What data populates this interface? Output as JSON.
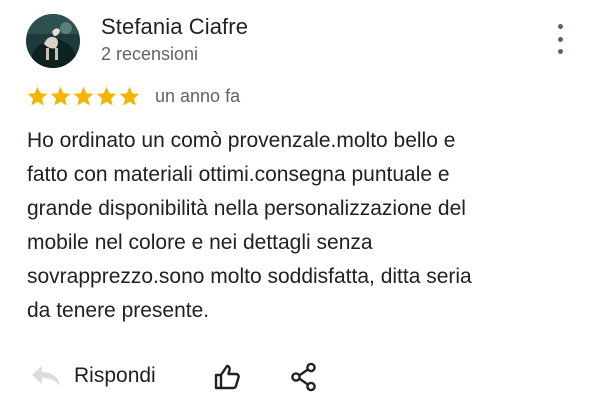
{
  "review": {
    "author": {
      "name": "Stefania Ciafre",
      "meta": "2 recensioni",
      "avatar_icon": "profile-photo-avatar"
    },
    "menu_icon": "more-vert-icon",
    "rating": {
      "stars": 5,
      "max": 5,
      "star_color": "#f4b400",
      "time": "un anno fa"
    },
    "text": "Ho ordinato un comò  provenzale.molto bello e\nfatto con materiali ottimi.consegna puntuale e\ngrande disponibilità  nella personalizzazione del\nmobile nel colore e nei dettagli senza\nsovrapprezzo.sono molto soddisfatta, ditta seria\nda tenere presente.",
    "actions": {
      "reply_label": "Rispondi",
      "reply_icon": "reply-arrow-icon",
      "like_icon": "thumbs-up-icon",
      "share_icon": "share-icon"
    }
  }
}
